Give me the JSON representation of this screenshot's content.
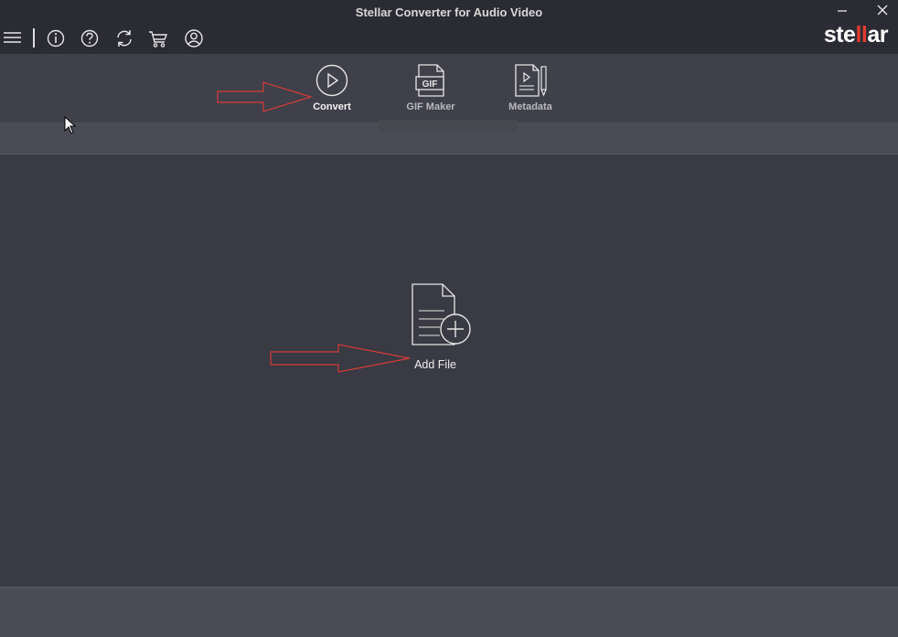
{
  "window": {
    "title": "Stellar Converter for Audio Video",
    "minimize_icon": "minimize-icon",
    "close_icon": "close-icon"
  },
  "toolbar": {
    "icons": [
      "hamburger-menu-icon",
      "info-icon",
      "help-icon",
      "update-icon",
      "cart-icon",
      "account-icon"
    ]
  },
  "logo": {
    "text_start": "ste",
    "text_mark": "ll",
    "text_end": "ar",
    "mark_color": "#e03b2f"
  },
  "ribbon": {
    "items": [
      {
        "label": "Convert",
        "icon": "play-circle-icon",
        "active": true
      },
      {
        "label": "GIF Maker",
        "icon": "gif-file-icon",
        "active": false
      },
      {
        "label": "Metadata",
        "icon": "metadata-file-icon",
        "active": false
      }
    ]
  },
  "main": {
    "add_file_label": "Add File",
    "add_file_icon": "add-file-icon"
  },
  "colors": {
    "titlebar": "#2a2b33",
    "ribbon": "#3f4049",
    "subbar": "#4a4b54",
    "main": "#393a43",
    "annotation_arrow": "#d63a3a"
  }
}
